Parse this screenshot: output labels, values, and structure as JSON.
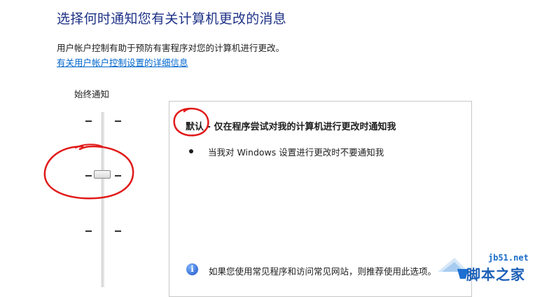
{
  "header": {
    "title": "选择何时通知您有关计算机更改的消息",
    "description": "用户帐户控制有助于预防有害程序对您的计算机进行更改。",
    "link": "有关用户帐户控制设置的详细信息"
  },
  "slider": {
    "top_label": "始终通知",
    "tick_count": 4,
    "selected_level": 2
  },
  "panel": {
    "heading": "默认 - 仅在程序尝试对我的计算机进行更改时通知我",
    "bullet": "当我对 Windows 设置进行更改时不要通知我",
    "info_text": "如果您使用常见程序和访问常见网站，则推荐使用此选项。",
    "info_icon": "info-icon"
  },
  "watermark": {
    "url": "jb51.net",
    "name": "脚本之家"
  },
  "annotation": {
    "color": "#e11a1a"
  }
}
